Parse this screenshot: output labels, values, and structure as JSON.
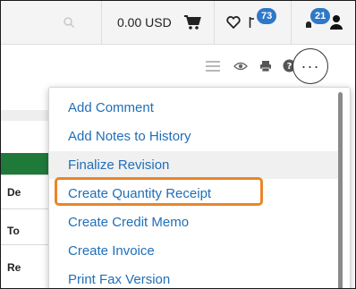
{
  "header": {
    "currency_text": "0.00 USD",
    "message_count": "73",
    "notification_count": "21"
  },
  "toolbar": {
    "more_label": "···"
  },
  "background_page": {
    "row_labels": [
      "De",
      "To",
      "Re"
    ]
  },
  "dropdown": {
    "items": [
      {
        "label": "Add Comment"
      },
      {
        "label": "Add Notes to History"
      },
      {
        "label": "Finalize Revision"
      },
      {
        "label": "Create Quantity Receipt"
      },
      {
        "label": "Create Credit Memo"
      },
      {
        "label": "Create Invoice"
      },
      {
        "label": "Print Fax Version"
      }
    ],
    "hovered_item": "Finalize Revision",
    "highlighted_item": "Create Quantity Receipt"
  },
  "colors": {
    "link_blue": "#1f6fb8",
    "badge_blue": "#2f78c8",
    "highlight_orange": "#e8862a",
    "header_green": "#1f7a3a"
  }
}
